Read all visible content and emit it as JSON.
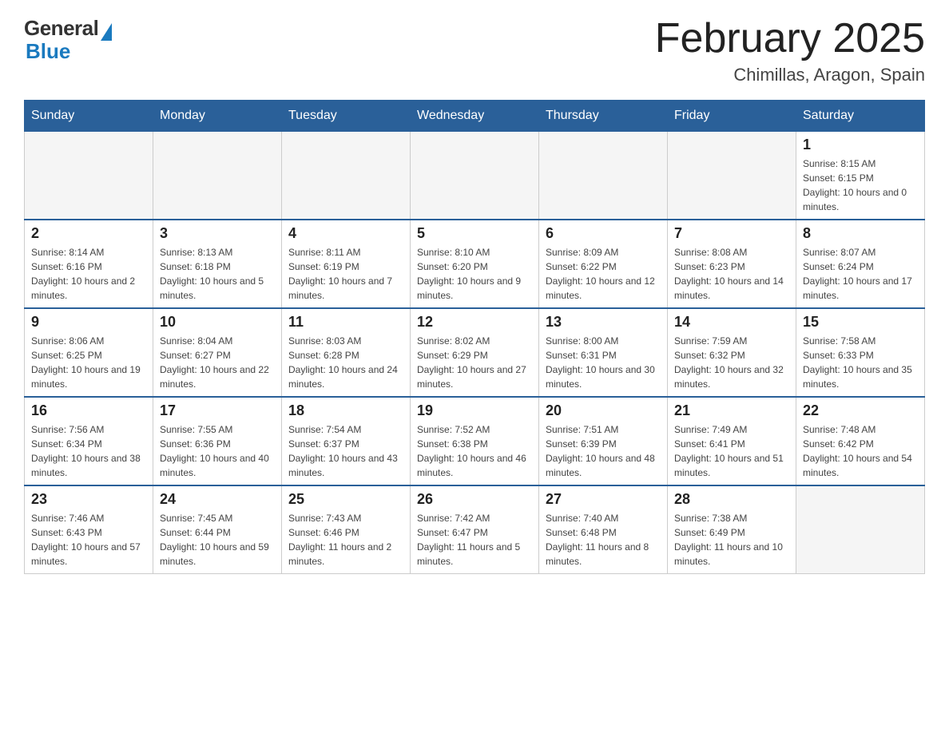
{
  "header": {
    "logo_general": "General",
    "logo_blue": "Blue",
    "title": "February 2025",
    "subtitle": "Chimillas, Aragon, Spain"
  },
  "weekdays": [
    "Sunday",
    "Monday",
    "Tuesday",
    "Wednesday",
    "Thursday",
    "Friday",
    "Saturday"
  ],
  "weeks": [
    [
      {
        "day": "",
        "empty": true
      },
      {
        "day": "",
        "empty": true
      },
      {
        "day": "",
        "empty": true
      },
      {
        "day": "",
        "empty": true
      },
      {
        "day": "",
        "empty": true
      },
      {
        "day": "",
        "empty": true
      },
      {
        "day": "1",
        "sunrise": "Sunrise: 8:15 AM",
        "sunset": "Sunset: 6:15 PM",
        "daylight": "Daylight: 10 hours and 0 minutes."
      }
    ],
    [
      {
        "day": "2",
        "sunrise": "Sunrise: 8:14 AM",
        "sunset": "Sunset: 6:16 PM",
        "daylight": "Daylight: 10 hours and 2 minutes."
      },
      {
        "day": "3",
        "sunrise": "Sunrise: 8:13 AM",
        "sunset": "Sunset: 6:18 PM",
        "daylight": "Daylight: 10 hours and 5 minutes."
      },
      {
        "day": "4",
        "sunrise": "Sunrise: 8:11 AM",
        "sunset": "Sunset: 6:19 PM",
        "daylight": "Daylight: 10 hours and 7 minutes."
      },
      {
        "day": "5",
        "sunrise": "Sunrise: 8:10 AM",
        "sunset": "Sunset: 6:20 PM",
        "daylight": "Daylight: 10 hours and 9 minutes."
      },
      {
        "day": "6",
        "sunrise": "Sunrise: 8:09 AM",
        "sunset": "Sunset: 6:22 PM",
        "daylight": "Daylight: 10 hours and 12 minutes."
      },
      {
        "day": "7",
        "sunrise": "Sunrise: 8:08 AM",
        "sunset": "Sunset: 6:23 PM",
        "daylight": "Daylight: 10 hours and 14 minutes."
      },
      {
        "day": "8",
        "sunrise": "Sunrise: 8:07 AM",
        "sunset": "Sunset: 6:24 PM",
        "daylight": "Daylight: 10 hours and 17 minutes."
      }
    ],
    [
      {
        "day": "9",
        "sunrise": "Sunrise: 8:06 AM",
        "sunset": "Sunset: 6:25 PM",
        "daylight": "Daylight: 10 hours and 19 minutes."
      },
      {
        "day": "10",
        "sunrise": "Sunrise: 8:04 AM",
        "sunset": "Sunset: 6:27 PM",
        "daylight": "Daylight: 10 hours and 22 minutes."
      },
      {
        "day": "11",
        "sunrise": "Sunrise: 8:03 AM",
        "sunset": "Sunset: 6:28 PM",
        "daylight": "Daylight: 10 hours and 24 minutes."
      },
      {
        "day": "12",
        "sunrise": "Sunrise: 8:02 AM",
        "sunset": "Sunset: 6:29 PM",
        "daylight": "Daylight: 10 hours and 27 minutes."
      },
      {
        "day": "13",
        "sunrise": "Sunrise: 8:00 AM",
        "sunset": "Sunset: 6:31 PM",
        "daylight": "Daylight: 10 hours and 30 minutes."
      },
      {
        "day": "14",
        "sunrise": "Sunrise: 7:59 AM",
        "sunset": "Sunset: 6:32 PM",
        "daylight": "Daylight: 10 hours and 32 minutes."
      },
      {
        "day": "15",
        "sunrise": "Sunrise: 7:58 AM",
        "sunset": "Sunset: 6:33 PM",
        "daylight": "Daylight: 10 hours and 35 minutes."
      }
    ],
    [
      {
        "day": "16",
        "sunrise": "Sunrise: 7:56 AM",
        "sunset": "Sunset: 6:34 PM",
        "daylight": "Daylight: 10 hours and 38 minutes."
      },
      {
        "day": "17",
        "sunrise": "Sunrise: 7:55 AM",
        "sunset": "Sunset: 6:36 PM",
        "daylight": "Daylight: 10 hours and 40 minutes."
      },
      {
        "day": "18",
        "sunrise": "Sunrise: 7:54 AM",
        "sunset": "Sunset: 6:37 PM",
        "daylight": "Daylight: 10 hours and 43 minutes."
      },
      {
        "day": "19",
        "sunrise": "Sunrise: 7:52 AM",
        "sunset": "Sunset: 6:38 PM",
        "daylight": "Daylight: 10 hours and 46 minutes."
      },
      {
        "day": "20",
        "sunrise": "Sunrise: 7:51 AM",
        "sunset": "Sunset: 6:39 PM",
        "daylight": "Daylight: 10 hours and 48 minutes."
      },
      {
        "day": "21",
        "sunrise": "Sunrise: 7:49 AM",
        "sunset": "Sunset: 6:41 PM",
        "daylight": "Daylight: 10 hours and 51 minutes."
      },
      {
        "day": "22",
        "sunrise": "Sunrise: 7:48 AM",
        "sunset": "Sunset: 6:42 PM",
        "daylight": "Daylight: 10 hours and 54 minutes."
      }
    ],
    [
      {
        "day": "23",
        "sunrise": "Sunrise: 7:46 AM",
        "sunset": "Sunset: 6:43 PM",
        "daylight": "Daylight: 10 hours and 57 minutes."
      },
      {
        "day": "24",
        "sunrise": "Sunrise: 7:45 AM",
        "sunset": "Sunset: 6:44 PM",
        "daylight": "Daylight: 10 hours and 59 minutes."
      },
      {
        "day": "25",
        "sunrise": "Sunrise: 7:43 AM",
        "sunset": "Sunset: 6:46 PM",
        "daylight": "Daylight: 11 hours and 2 minutes."
      },
      {
        "day": "26",
        "sunrise": "Sunrise: 7:42 AM",
        "sunset": "Sunset: 6:47 PM",
        "daylight": "Daylight: 11 hours and 5 minutes."
      },
      {
        "day": "27",
        "sunrise": "Sunrise: 7:40 AM",
        "sunset": "Sunset: 6:48 PM",
        "daylight": "Daylight: 11 hours and 8 minutes."
      },
      {
        "day": "28",
        "sunrise": "Sunrise: 7:38 AM",
        "sunset": "Sunset: 6:49 PM",
        "daylight": "Daylight: 11 hours and 10 minutes."
      },
      {
        "day": "",
        "empty": true
      }
    ]
  ]
}
